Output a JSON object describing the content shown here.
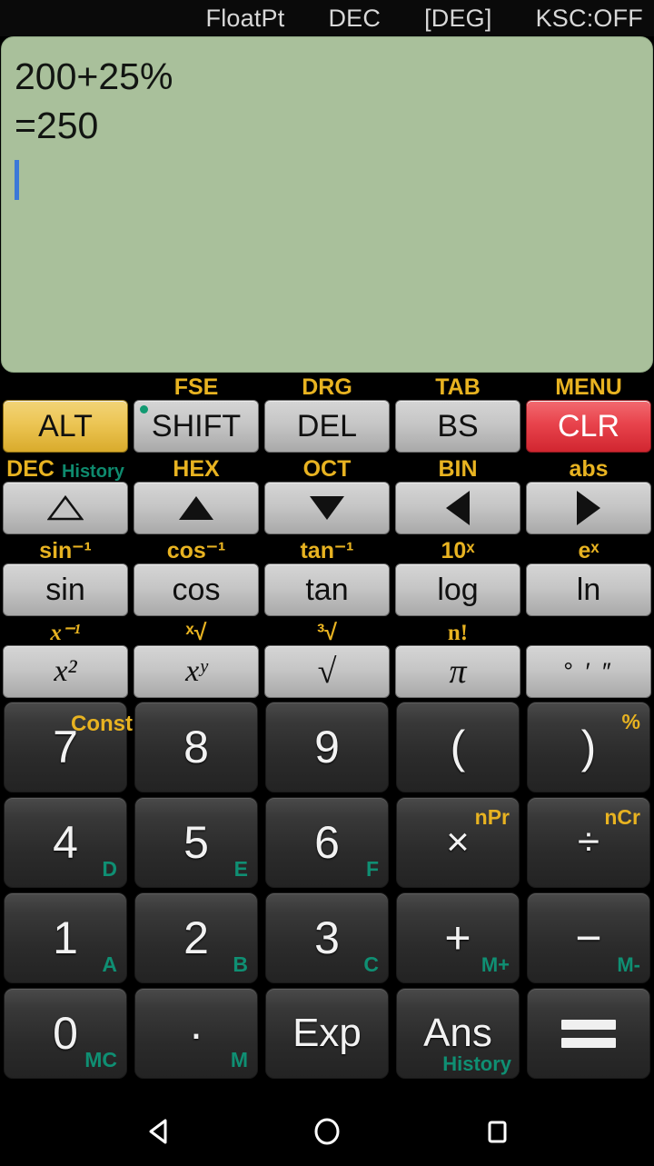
{
  "status_bar": {
    "items": [
      {
        "name": "float-mode",
        "label": "FloatPt"
      },
      {
        "name": "base-mode",
        "label": "DEC"
      },
      {
        "name": "angle-mode",
        "label": "[DEG]"
      },
      {
        "name": "ksc-mode",
        "label": "KSC:OFF"
      }
    ]
  },
  "display": {
    "background_color": "#a9c09b",
    "cursor_color": "#3b78d8",
    "lines": [
      {
        "text": "200+25%"
      },
      {
        "text": "=250"
      }
    ],
    "expression": "200+25%",
    "result": "=250",
    "cursor_visible": "true"
  },
  "colors": {
    "gold": "#e8b321",
    "teal": "#0f8f73",
    "alt_key": "#ecc554",
    "clr_key": "#e8434c",
    "light_key": "#c6c6c6",
    "dark_key": "#2b2b2b"
  },
  "keypad": {
    "rows": [
      {
        "name": "row-modifiers",
        "keys": [
          {
            "name": "alt",
            "label": "ALT",
            "sub_gold": "",
            "sub_teal": "",
            "style": "alt"
          },
          {
            "name": "shift",
            "label": "SHIFT",
            "sub_gold": "FSE",
            "sub_teal": "",
            "style": "light",
            "indicator": "on"
          },
          {
            "name": "del",
            "label": "DEL",
            "sub_gold": "DRG",
            "sub_teal": "",
            "style": "light"
          },
          {
            "name": "backspace",
            "label": "BS",
            "sub_gold": "TAB",
            "sub_teal": "",
            "style": "light"
          },
          {
            "name": "clear",
            "label": "CLR",
            "sub_gold": "MENU",
            "sub_teal": "",
            "style": "clr"
          }
        ]
      },
      {
        "name": "row-arrows",
        "keys": [
          {
            "name": "arrow-up-hollow",
            "label": "△",
            "sub_gold": "DEC",
            "sub_teal": "History",
            "style": "light"
          },
          {
            "name": "arrow-up",
            "label": "▲",
            "sub_gold": "HEX",
            "sub_teal": "",
            "style": "light"
          },
          {
            "name": "arrow-down",
            "label": "▼",
            "sub_gold": "OCT",
            "sub_teal": "",
            "style": "light"
          },
          {
            "name": "arrow-left",
            "label": "◀",
            "sub_gold": "BIN",
            "sub_teal": "",
            "style": "light"
          },
          {
            "name": "arrow-right",
            "label": "▶",
            "sub_gold": "abs",
            "sub_teal": "",
            "style": "light"
          }
        ]
      },
      {
        "name": "row-trig",
        "keys": [
          {
            "name": "sin",
            "label": "sin",
            "sub_gold": "sin⁻¹",
            "sub_teal": "",
            "style": "light"
          },
          {
            "name": "cos",
            "label": "cos",
            "sub_gold": "cos⁻¹",
            "sub_teal": "",
            "style": "light"
          },
          {
            "name": "tan",
            "label": "tan",
            "sub_gold": "tan⁻¹",
            "sub_teal": "",
            "style": "light"
          },
          {
            "name": "log",
            "label": "log",
            "sub_gold": "10ˣ",
            "sub_teal": "",
            "style": "light"
          },
          {
            "name": "ln",
            "label": "ln",
            "sub_gold": "eˣ",
            "sub_teal": "",
            "style": "light"
          }
        ]
      },
      {
        "name": "row-power",
        "keys": [
          {
            "name": "x-squared",
            "label": "x²",
            "sub_gold": "x⁻¹",
            "sub_teal": "",
            "style": "light"
          },
          {
            "name": "x-to-y",
            "label": "xʸ",
            "sub_gold": "ˣ√",
            "sub_teal": "",
            "style": "light"
          },
          {
            "name": "square-root",
            "label": "√",
            "sub_gold": "³√",
            "sub_teal": "",
            "style": "light"
          },
          {
            "name": "pi",
            "label": "π",
            "sub_gold": "n!",
            "sub_teal": "",
            "style": "light"
          },
          {
            "name": "degree-minute-second",
            "label": "° ′ ″",
            "sub_gold": "",
            "sub_teal": "",
            "style": "light"
          }
        ]
      }
    ],
    "numeric_rows": [
      {
        "name": "row-789",
        "keys": [
          {
            "name": "seven",
            "label": "7",
            "top_right": "Const",
            "bottom_right": "",
            "const_style": "true"
          },
          {
            "name": "eight",
            "label": "8",
            "top_right": "",
            "bottom_right": ""
          },
          {
            "name": "nine",
            "label": "9",
            "top_right": "",
            "bottom_right": ""
          },
          {
            "name": "paren-open",
            "label": "(",
            "top_right": "",
            "bottom_right": ""
          },
          {
            "name": "paren-close",
            "label": ")",
            "top_right": "%",
            "bottom_right": ""
          }
        ]
      },
      {
        "name": "row-456",
        "keys": [
          {
            "name": "four",
            "label": "4",
            "top_right": "",
            "bottom_right": "D"
          },
          {
            "name": "five",
            "label": "5",
            "top_right": "",
            "bottom_right": "E"
          },
          {
            "name": "six",
            "label": "6",
            "top_right": "",
            "bottom_right": "F"
          },
          {
            "name": "multiply",
            "label": "×",
            "top_right": "nPr",
            "bottom_right": ""
          },
          {
            "name": "divide",
            "label": "÷",
            "top_right": "nCr",
            "bottom_right": ""
          }
        ]
      },
      {
        "name": "row-123",
        "keys": [
          {
            "name": "one",
            "label": "1",
            "top_right": "",
            "bottom_right": "A"
          },
          {
            "name": "two",
            "label": "2",
            "top_right": "",
            "bottom_right": "B"
          },
          {
            "name": "three",
            "label": "3",
            "top_right": "",
            "bottom_right": "C"
          },
          {
            "name": "plus",
            "label": "+",
            "top_right": "",
            "bottom_right": "M+"
          },
          {
            "name": "minus",
            "label": "−",
            "top_right": "",
            "bottom_right": "M-"
          }
        ]
      },
      {
        "name": "row-zero",
        "keys": [
          {
            "name": "zero",
            "label": "0",
            "top_right": "",
            "bottom_right": "MC"
          },
          {
            "name": "decimal-point",
            "label": "·",
            "top_right": "",
            "bottom_right": "M"
          },
          {
            "name": "exponent",
            "label": "Exp",
            "top_right": "",
            "bottom_right": ""
          },
          {
            "name": "answer",
            "label": "Ans",
            "top_right": "",
            "bottom_right": "History"
          },
          {
            "name": "equals",
            "label": "=",
            "top_right": "",
            "bottom_right": ""
          }
        ]
      }
    ]
  },
  "nav_bar": {
    "buttons": [
      {
        "name": "android-back",
        "icon": "back-triangle-icon"
      },
      {
        "name": "android-home",
        "icon": "home-circle-icon"
      },
      {
        "name": "android-recents",
        "icon": "recents-square-icon"
      }
    ]
  }
}
